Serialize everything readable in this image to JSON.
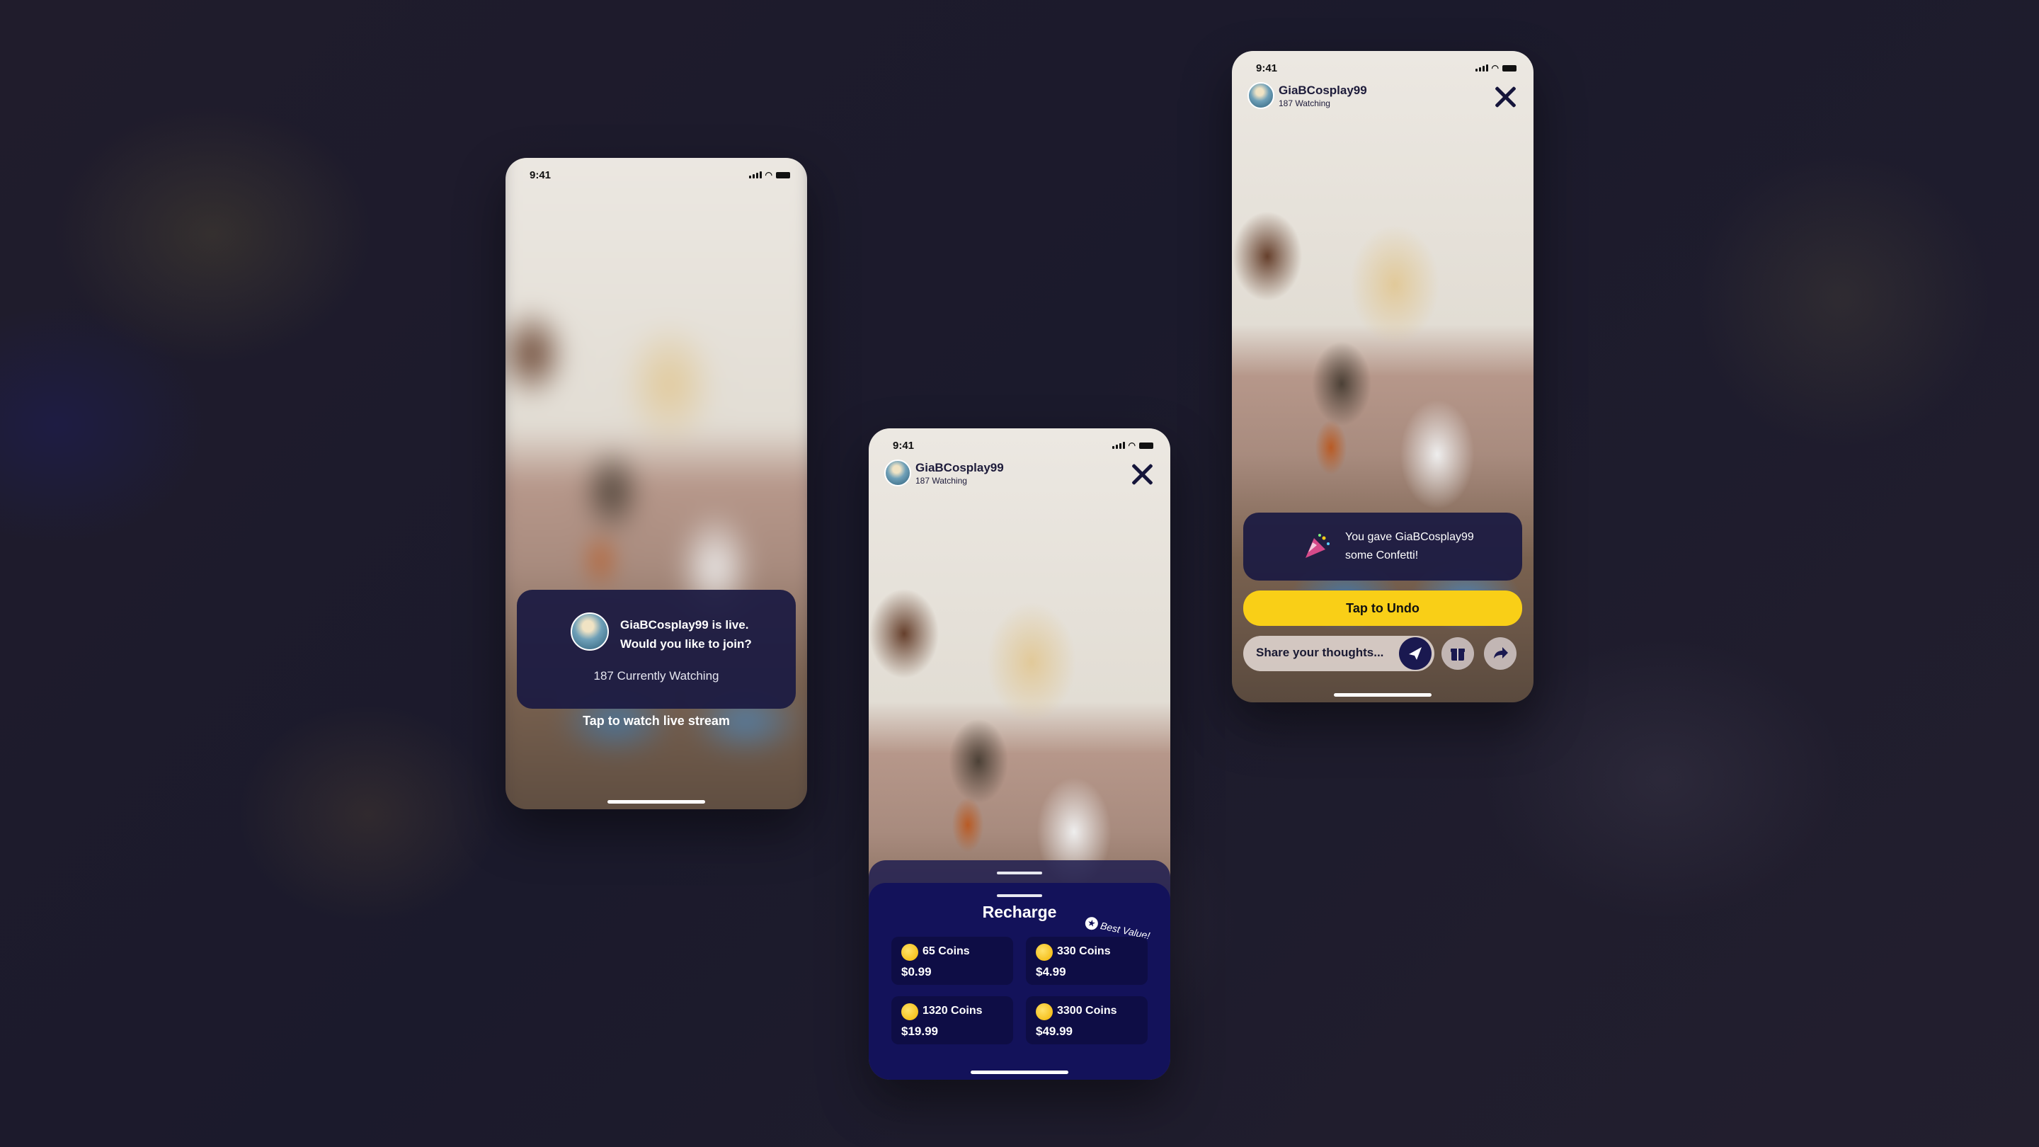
{
  "status_time": "9:41",
  "join_screen": {
    "message_line1": "GiaBCosplay99 is live.",
    "message_line2": "Would you like to join?",
    "watching": "187 Currently Watching",
    "tap_label": "Tap to watch live stream"
  },
  "streamer": {
    "name": "GiaBCosplay99",
    "watching": "187 Watching"
  },
  "recharge": {
    "title": "Recharge",
    "badge": "Best Value!",
    "packages": [
      {
        "coins": "65 Coins",
        "price": "$0.99"
      },
      {
        "coins": "330 Coins",
        "price": "$4.99"
      },
      {
        "coins": "1320 Coins",
        "price": "$19.99"
      },
      {
        "coins": "3300 Coins",
        "price": "$49.99"
      }
    ]
  },
  "gift_screen": {
    "toast_line1": "You gave GiaBCosplay99",
    "toast_line2": "some Confetti!",
    "undo_label": "Tap to Undo",
    "chat_placeholder": "Share your thoughts..."
  },
  "colors": {
    "card_navy": "#1c1b42",
    "sheet_navy": "#13125a",
    "accent_yellow": "#f9cf17"
  }
}
